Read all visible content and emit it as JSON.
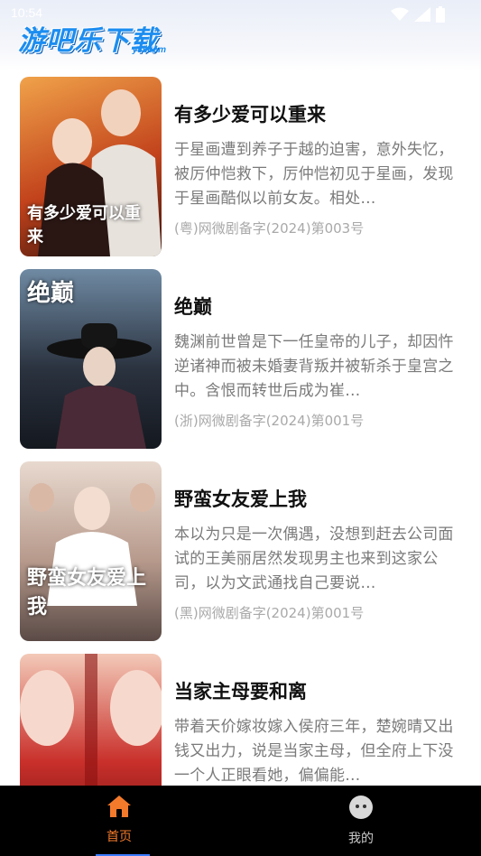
{
  "status": {
    "time": "10:54"
  },
  "app": {
    "logo_text": "游吧乐下载",
    "logo_sub": "y8l.com"
  },
  "dramas": [
    {
      "poster_text": "有多少爱可以重来",
      "title": "有多少爱可以重来",
      "description": "于星画遭到养子于越的迫害，意外失忆，被厉仲恺救下，厉仲恺初见于星画，发现于星画酷似以前女友。相处…",
      "record": "(粤)网微剧备字(2024)第003号",
      "poster_colors": [
        "#f0a24a",
        "#c2431c",
        "#3a120c"
      ]
    },
    {
      "poster_text": "绝巅",
      "title": "绝巅",
      "description": "魏渊前世曾是下一任皇帝的儿子，却因忤逆诸神而被未婚妻背叛并被斩杀于皇宫之中。含恨而转世后成为崔…",
      "record": "(浙)网微剧备字(2024)第001号",
      "poster_colors": [
        "#6f8aa3",
        "#2b3340",
        "#14181f"
      ]
    },
    {
      "poster_text": "野蛮女友爱上我",
      "title": "野蛮女友爱上我",
      "description": "本以为只是一次偶遇，没想到赶去公司面试的王美丽居然发现男主也来到这家公司，以为文武通找自己要说…",
      "record": "(黑)网微剧备字(2024)第001号",
      "poster_colors": [
        "#e8d9cf",
        "#b79a8c",
        "#5a4a46"
      ]
    },
    {
      "poster_text": "",
      "title": "当家主母要和离",
      "description": "带着天价嫁妆嫁入侯府三年，楚婉晴又出钱又出力，说是当家主母，但全府上下没一个人正眼看她，偏偏能…",
      "record": "",
      "poster_colors": [
        "#f3c9b8",
        "#c9302b",
        "#7a1414"
      ]
    }
  ],
  "nav": {
    "home_label": "首页",
    "me_label": "我的"
  },
  "colors": {
    "accent": "#f47a2b",
    "logo_blue": "#1c8df0",
    "navbar_bg": "#000000"
  }
}
